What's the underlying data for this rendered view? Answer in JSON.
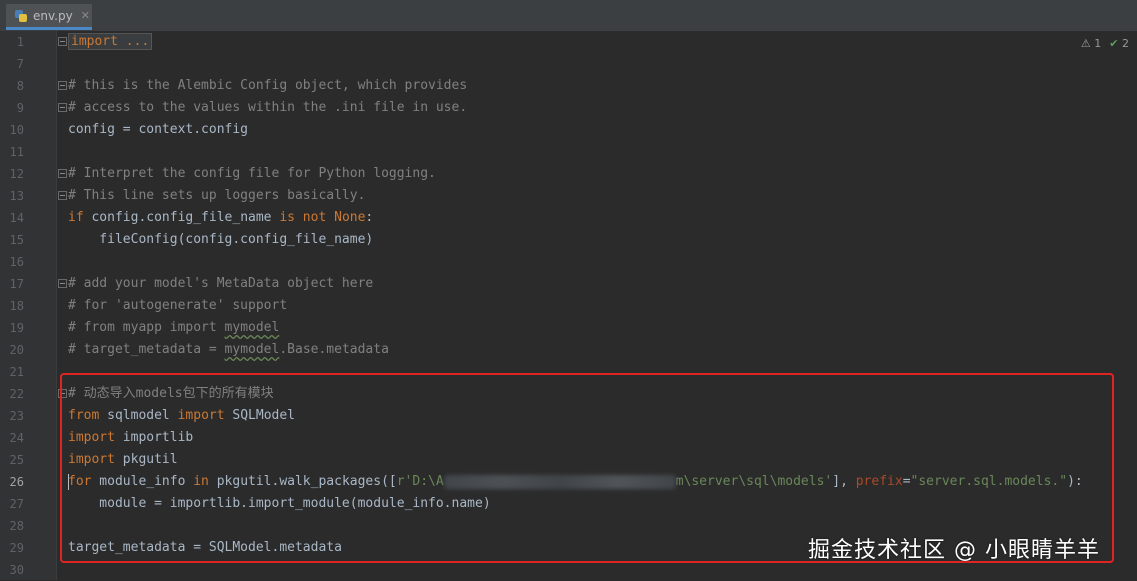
{
  "tab": {
    "filename": "env.py",
    "close": "✕"
  },
  "inspection": {
    "warnings": "1",
    "checks": "2"
  },
  "lines": [
    {
      "num": "1",
      "y": 0
    },
    {
      "num": "7"
    },
    {
      "num": "8"
    },
    {
      "num": "9"
    },
    {
      "num": "10"
    },
    {
      "num": "11"
    },
    {
      "num": "12"
    },
    {
      "num": "13"
    },
    {
      "num": "14"
    },
    {
      "num": "15"
    },
    {
      "num": "16"
    },
    {
      "num": "17"
    },
    {
      "num": "18"
    },
    {
      "num": "19"
    },
    {
      "num": "20"
    },
    {
      "num": "21"
    },
    {
      "num": "22"
    },
    {
      "num": "23"
    },
    {
      "num": "24"
    },
    {
      "num": "25"
    },
    {
      "num": "26"
    },
    {
      "num": "27"
    },
    {
      "num": "28"
    },
    {
      "num": "29"
    },
    {
      "num": "30"
    }
  ],
  "code": {
    "l1": "import ...",
    "l8": "# this is the Alembic Config object, which provides",
    "l9": "# access to the values within the .ini file in use.",
    "l10": "config = context.config",
    "l12": "# Interpret the config file for Python logging.",
    "l13": "# This line sets up loggers basically.",
    "l14_kw1": "if",
    "l14_a": " config.config_file_name ",
    "l14_kw2": "is not None",
    "l14_b": ":",
    "l15": "    fileConfig(config.config_file_name)",
    "l17": "# add your model's MetaData object here",
    "l18": "# for 'autogenerate' support",
    "l19_a": "# from myapp import ",
    "l19_b": "mymodel",
    "l20_a": "# target_metadata = ",
    "l20_b": "mymodel",
    "l20_c": ".Base.metadata",
    "l22": "# 动态导入models包下的所有模块",
    "l23_kw1": "from",
    "l23_a": " sqlmodel ",
    "l23_kw2": "import",
    "l23_b": " SQLModel",
    "l24_kw": "import",
    "l24_a": " importlib",
    "l25_kw": "import",
    "l25_a": " pkgutil",
    "l26_kw1": "for",
    "l26_a": " module_info ",
    "l26_kw2": "in",
    "l26_b": " pkgutil.walk_packages([",
    "l26_str1": "r'D:\\A",
    "l26_str2": "m\\server\\sql\\models'",
    "l26_c": "], ",
    "l26_param": "prefix",
    "l26_d": "=",
    "l26_str3": "\"server.sql.models.\"",
    "l26_e": "):",
    "l27": "    module = importlib.import_module(module_info.name)",
    "l29": "target_metadata = SQLModel.metadata"
  },
  "watermark": "掘金技术社区 @ 小眼睛羊羊"
}
